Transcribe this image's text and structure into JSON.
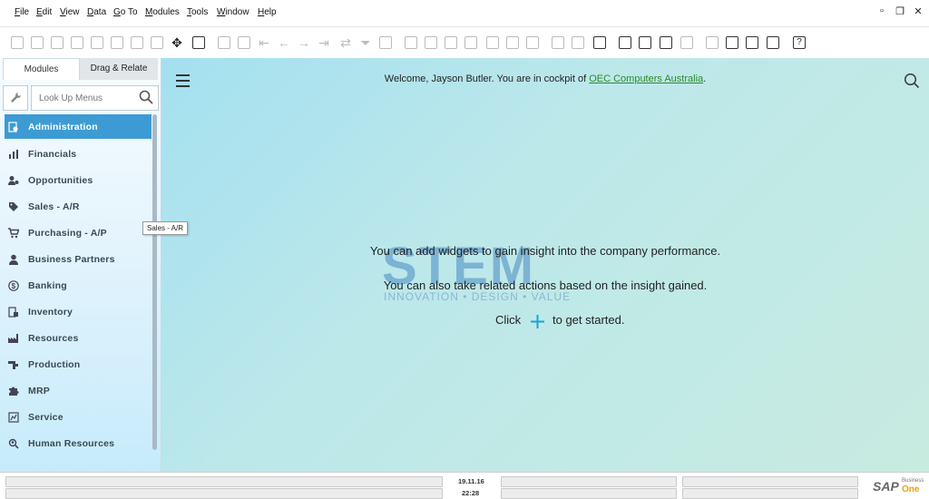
{
  "menubar": {
    "items": [
      "File",
      "Edit",
      "View",
      "Data",
      "Go To",
      "Modules",
      "Tools",
      "Window",
      "Help"
    ]
  },
  "sidebar": {
    "tabs": {
      "modules": "Modules",
      "drag_relate": "Drag & Relate"
    },
    "search_placeholder": "Look Up Menus",
    "modules": [
      {
        "label": "Administration",
        "icon": "admin-icon",
        "active": true
      },
      {
        "label": "Financials",
        "icon": "chart-icon"
      },
      {
        "label": "Opportunities",
        "icon": "person-money-icon"
      },
      {
        "label": "Sales - A/R",
        "icon": "tag-icon"
      },
      {
        "label": "Purchasing - A/P",
        "icon": "cart-icon"
      },
      {
        "label": "Business Partners",
        "icon": "person-icon"
      },
      {
        "label": "Banking",
        "icon": "dollar-icon"
      },
      {
        "label": "Inventory",
        "icon": "inventory-icon"
      },
      {
        "label": "Resources",
        "icon": "factory-icon"
      },
      {
        "label": "Production",
        "icon": "production-icon"
      },
      {
        "label": "MRP",
        "icon": "puzzle-icon"
      },
      {
        "label": "Service",
        "icon": "service-icon"
      },
      {
        "label": "Human Resources",
        "icon": "hr-icon"
      }
    ],
    "tooltip": "Sales - A/R"
  },
  "main": {
    "welcome_prefix": "Welcome, Jayson Butler. You are in cockpit of ",
    "company": "OEC Computers Australia",
    "welcome_suffix": ".",
    "message1": "You can add widgets to gain insight into the company performance.",
    "message2": "You can also take related actions based on the insight gained.",
    "click_label": "Click",
    "get_started": "to get started.",
    "watermark": {
      "letters": "STEM",
      "tagline": "INNOVATION • DESIGN • VALUE"
    }
  },
  "statusbar": {
    "date": "19.11.16",
    "time": "22:28",
    "logo": {
      "sap": "SAP",
      "business": "Business",
      "one": "One"
    }
  },
  "colors": {
    "active_module": "#3d9bd4",
    "company_link": "#2b8a2b",
    "plus_icon": "#1aa3d9",
    "sap_one": "#e8a317"
  }
}
